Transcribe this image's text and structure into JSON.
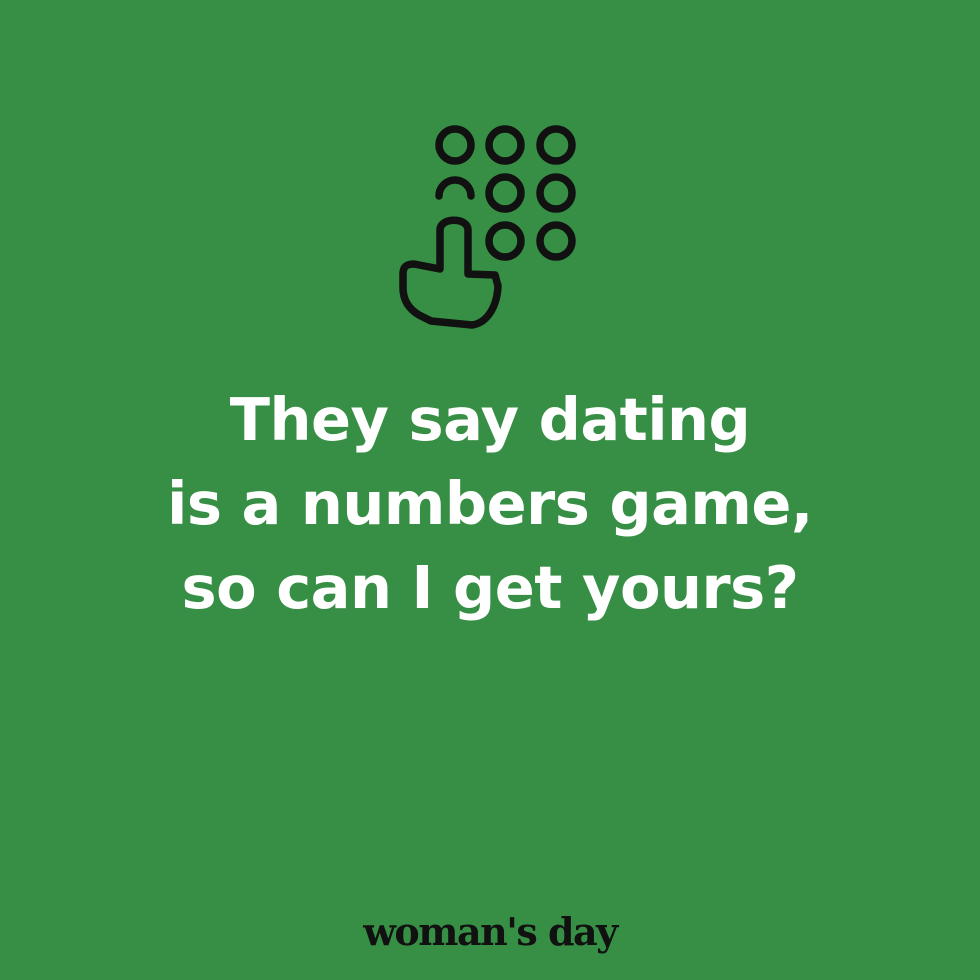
{
  "background_color": "#368f44",
  "icon": {
    "name": "keypad-finger-press-icon",
    "color": "#111111"
  },
  "quote": {
    "lines": [
      "They say dating",
      "is a numbers game,",
      "so can I get yours?"
    ],
    "color": "#ffffff"
  },
  "brand": {
    "logo_text": "woman's day",
    "color": "#111111"
  }
}
